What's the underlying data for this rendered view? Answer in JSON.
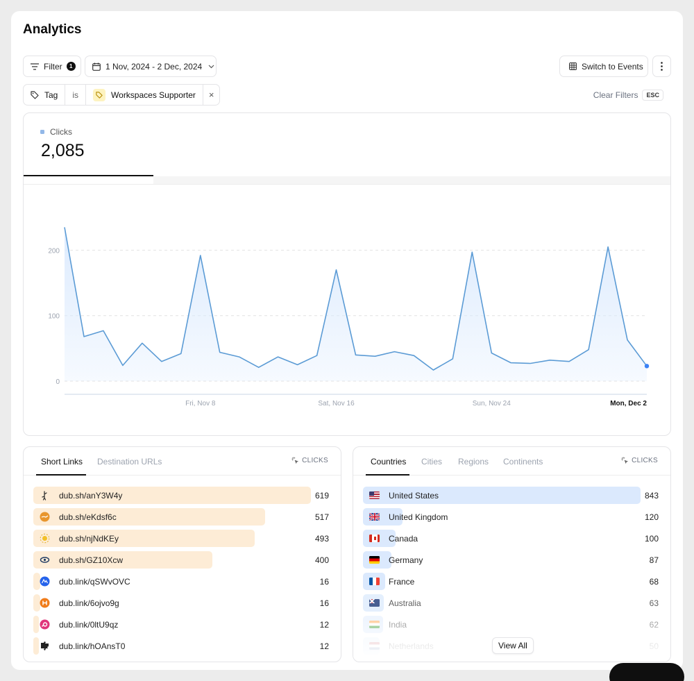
{
  "page": {
    "title": "Analytics"
  },
  "toolbar": {
    "filter_label": "Filter",
    "filter_count": "1",
    "date_range": "1 Nov, 2024 - 2 Dec, 2024",
    "switch_label": "Switch to Events"
  },
  "active_filter": {
    "key": "Tag",
    "operator": "is",
    "value": "Workspaces Supporter",
    "remove_glyph": "×"
  },
  "clear_filters": {
    "label": "Clear Filters",
    "shortcut": "ESC"
  },
  "metric": {
    "label": "Clicks",
    "value": "2,085",
    "color": "#93b8e8"
  },
  "colors": {
    "line": "#5b9bd5",
    "fill": "#dbeafe",
    "link_bar": "#fdecd6",
    "country_bar": "#dbe9fd"
  },
  "chart_data": {
    "type": "area",
    "x": [
      "Nov 1",
      "Nov 2",
      "Nov 3",
      "Nov 4",
      "Nov 5",
      "Nov 6",
      "Nov 7",
      "Nov 8",
      "Nov 9",
      "Nov 10",
      "Nov 11",
      "Nov 12",
      "Nov 13",
      "Nov 14",
      "Nov 15",
      "Nov 16",
      "Nov 17",
      "Nov 18",
      "Nov 19",
      "Nov 20",
      "Nov 21",
      "Nov 22",
      "Nov 23",
      "Nov 24",
      "Nov 25",
      "Nov 26",
      "Nov 27",
      "Nov 28",
      "Nov 29",
      "Nov 30",
      "Dec 1",
      "Dec 2"
    ],
    "series": [
      {
        "values": [
          235,
          68,
          77,
          24,
          58,
          30,
          42,
          192,
          44,
          37,
          21,
          37,
          25,
          39,
          170,
          40,
          38,
          45,
          39,
          17,
          34,
          197,
          43,
          28,
          27,
          32,
          30,
          48,
          205,
          63,
          23
        ]
      }
    ],
    "ylim": [
      0,
      240
    ],
    "yticks": [
      0,
      100,
      200
    ],
    "xtick_labels": [
      {
        "label": "Fri, Nov 8",
        "index": 7,
        "bold": false
      },
      {
        "label": "Sat, Nov 16",
        "index": 14,
        "bold": false
      },
      {
        "label": "Sun, Nov 24",
        "index": 22,
        "bold": false
      },
      {
        "label": "Mon, Dec 2",
        "index": 30,
        "bold": true
      }
    ],
    "grid": true
  },
  "links_panel": {
    "tabs": [
      "Short Links",
      "Destination URLs"
    ],
    "clicks_header": "CLICKS",
    "max": 619,
    "rows": [
      {
        "label": "dub.sh/anY3W4y",
        "value": 619,
        "icon": "figure-icon"
      },
      {
        "label": "dub.sh/eKdsf6c",
        "value": 517,
        "icon": "bird-icon"
      },
      {
        "label": "dub.sh/njNdKEy",
        "value": 493,
        "icon": "sun-icon"
      },
      {
        "label": "dub.sh/GZ10Xcw",
        "value": 400,
        "icon": "eye-icon"
      },
      {
        "label": "dub.link/qSWvOVC",
        "value": 16,
        "icon": "wave-icon"
      },
      {
        "label": "dub.link/6ojvo9g",
        "value": 16,
        "icon": "hex-icon"
      },
      {
        "label": "dub.link/0ltU9qz",
        "value": 12,
        "icon": "spiral-icon"
      },
      {
        "label": "dub.link/hOAnsT0",
        "value": 12,
        "icon": "puzzle-icon"
      }
    ]
  },
  "countries_panel": {
    "tabs": [
      "Countries",
      "Cities",
      "Regions",
      "Continents"
    ],
    "clicks_header": "CLICKS",
    "max": 843,
    "rows": [
      {
        "label": "United States",
        "value": 843,
        "flag": "us-flag-icon"
      },
      {
        "label": "United Kingdom",
        "value": 120,
        "flag": "uk-flag-icon"
      },
      {
        "label": "Canada",
        "value": 100,
        "flag": "ca-flag-icon"
      },
      {
        "label": "Germany",
        "value": 87,
        "flag": "de-flag-icon"
      },
      {
        "label": "France",
        "value": 68,
        "flag": "fr-flag-icon"
      },
      {
        "label": "Australia",
        "value": 63,
        "flag": "au-flag-icon"
      },
      {
        "label": "India",
        "value": 62,
        "flag": "in-flag-icon"
      },
      {
        "label": "Netherlands",
        "value": 50,
        "flag": "nl-flag-icon"
      }
    ],
    "view_all": "View All"
  }
}
